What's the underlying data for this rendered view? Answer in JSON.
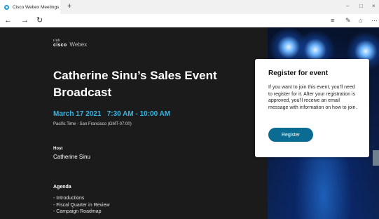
{
  "browser": {
    "tab_title": "Cisco Webex Meetings",
    "new_tab_label": "+",
    "window_controls": [
      "–",
      "□",
      "×"
    ],
    "nav": {
      "back": "←",
      "forward": "→",
      "refresh": "↻"
    },
    "tools": [
      "≡",
      "✎",
      "⌂",
      "···"
    ]
  },
  "page": {
    "logo": {
      "bars": "ılıılı",
      "brand": "cisco",
      "product": "Webex"
    },
    "event_title": "Catherine Sinu’s Sales Event Broadcast",
    "event_date": "March 17 2021   7:30 AM - 10:00 AM",
    "timezone": "Pacific Time - San Francisco (GMT-07:00)",
    "host_label": "Host",
    "host_name": "Catherine Sinu",
    "agenda_label": "Agenda",
    "agenda_items": [
      "- Introductions",
      "- Fiscal Quarter in Review",
      "- Campaign Roadmap"
    ]
  },
  "register_card": {
    "title": "Register for event",
    "body": "If you want to join this event, you’ll need to register for it. After your registration is approved, you’ll receive an email message with information on how to join.",
    "button_label": "Register"
  },
  "colors": {
    "accent": "#33b6e8",
    "button": "#0b6c93",
    "page_bg": "#1b1b1b"
  }
}
